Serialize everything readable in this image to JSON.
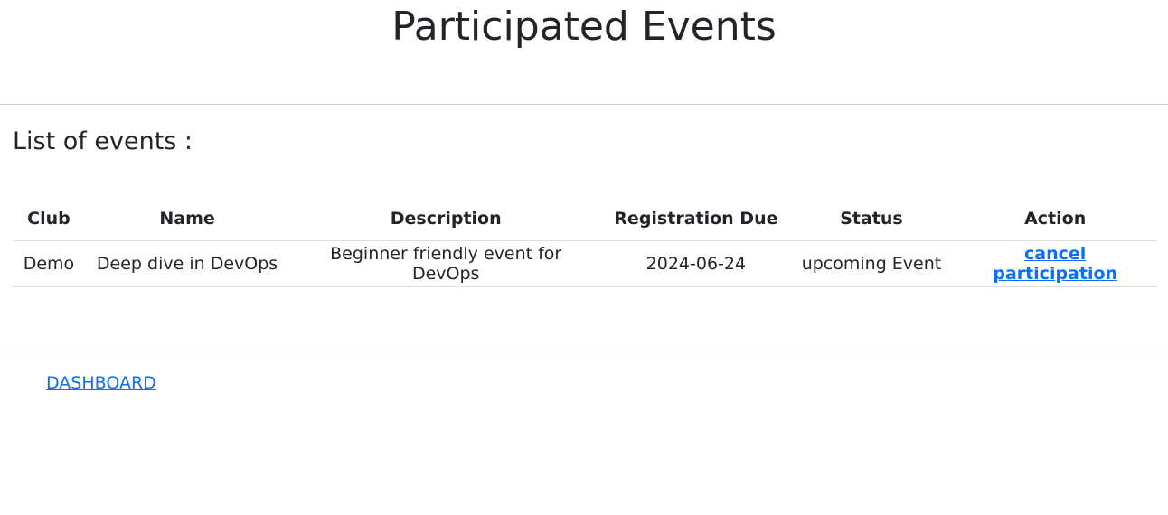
{
  "page": {
    "title": "Participated Events"
  },
  "events_section": {
    "heading": "List of events :",
    "table": {
      "columns": [
        "Club",
        "Name",
        "Description",
        "Registration Due",
        "Status",
        "Action"
      ],
      "rows": [
        {
          "club": "Demo",
          "name": "Deep dive in DevOps",
          "description": "Beginner friendly event for DevOps",
          "registration_due": "2024-06-24",
          "status": "upcoming Event",
          "action_label": "cancel participation"
        }
      ]
    }
  },
  "footer": {
    "dashboard_link": "DASHBOARD"
  },
  "colors": {
    "link": "#0d6efd",
    "text": "#212529",
    "divider": "#cfd2d6"
  }
}
